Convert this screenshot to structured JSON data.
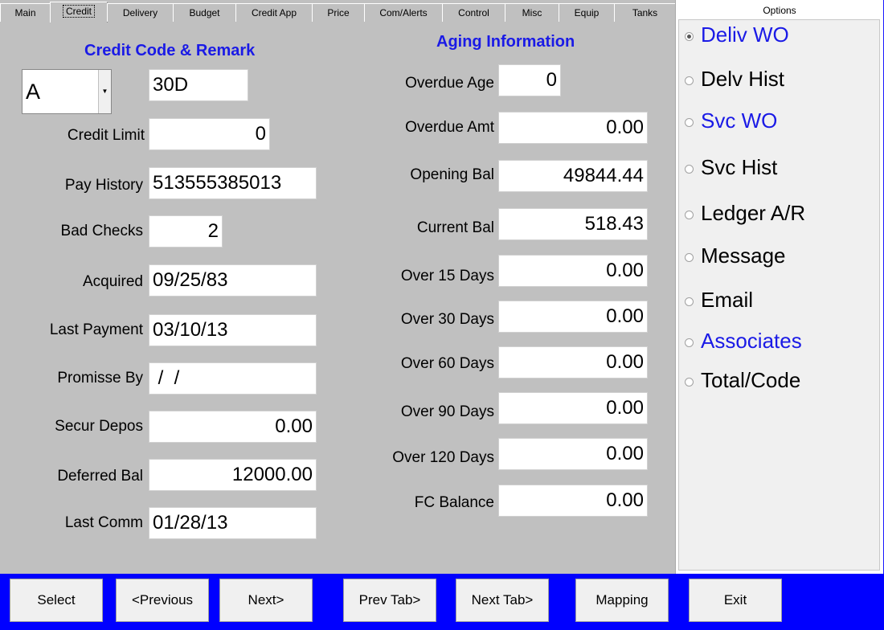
{
  "tabs": [
    "Main",
    "Credit",
    "Delivery",
    "Budget",
    "Credit App",
    "Price",
    "Com/Alerts",
    "Control",
    "Misc",
    "Equip",
    "Tanks"
  ],
  "credit": {
    "heading": "Credit Code & Remark",
    "credit_code": "A",
    "remark": "30D",
    "fields": [
      {
        "label": "Credit Limit",
        "value": "0"
      },
      {
        "label": "Pay History",
        "value": "513555385013"
      },
      {
        "label": "Bad Checks",
        "value": "2"
      },
      {
        "label": "Acquired",
        "value": "09/25/83"
      },
      {
        "label": "Last Payment",
        "value": "03/10/13"
      },
      {
        "label": "Promisse By",
        "value": " /  /"
      },
      {
        "label": "Secur Depos",
        "value": "0.00"
      },
      {
        "label": "Deferred Bal",
        "value": "12000.00"
      },
      {
        "label": "Last Comm",
        "value": "01/28/13"
      }
    ]
  },
  "aging": {
    "heading": "Aging Information",
    "fields": [
      {
        "label": "Overdue Age",
        "value": "0"
      },
      {
        "label": "Overdue Amt",
        "value": "0.00"
      },
      {
        "label": "Opening Bal",
        "value": "49844.44"
      },
      {
        "label": "Current Bal",
        "value": "518.43"
      },
      {
        "label": "Over 15 Days",
        "value": "0.00"
      },
      {
        "label": "Over 30 Days",
        "value": "0.00"
      },
      {
        "label": "Over 60 Days",
        "value": "0.00"
      },
      {
        "label": "Over 90 Days",
        "value": "0.00"
      },
      {
        "label": "Over 120 Days",
        "value": "0.00"
      },
      {
        "label": "FC Balance",
        "value": "0.00"
      }
    ]
  },
  "options": {
    "title": "Options",
    "items": [
      {
        "label": "Deliv WO",
        "selected": true,
        "color": "#1a1ae6"
      },
      {
        "label": "Delv Hist",
        "selected": false,
        "color": "#000000"
      },
      {
        "label": "Svc WO",
        "selected": false,
        "color": "#1a1ae6"
      },
      {
        "label": "Svc Hist",
        "selected": false,
        "color": "#000000"
      },
      {
        "label": "Ledger A/R",
        "selected": false,
        "color": "#000000"
      },
      {
        "label": "Message",
        "selected": false,
        "color": "#000000"
      },
      {
        "label": "Email",
        "selected": false,
        "color": "#000000"
      },
      {
        "label": "Associates",
        "selected": false,
        "color": "#1a1ae6"
      },
      {
        "label": "Total/Code",
        "selected": false,
        "color": "#000000"
      }
    ]
  },
  "buttons": [
    "Select",
    "<Previous",
    "Next>",
    "Prev Tab>",
    "Next Tab>",
    "Mapping",
    "Exit"
  ],
  "colors": {
    "bottom_bar": "#0000ff",
    "heading": "#1a1ae6"
  }
}
